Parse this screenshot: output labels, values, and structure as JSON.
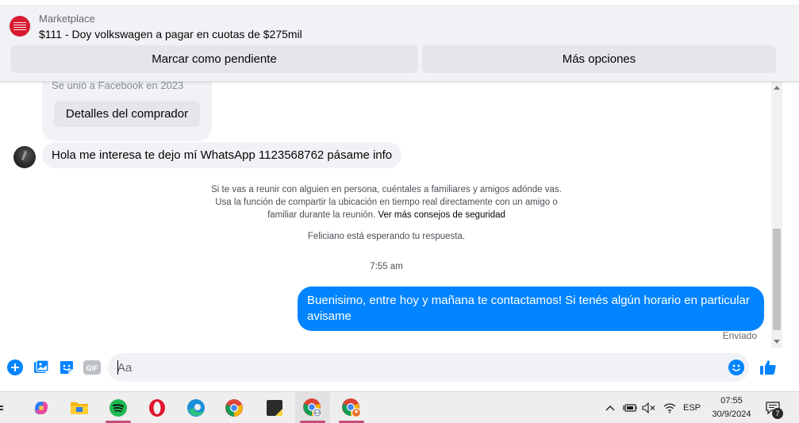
{
  "header": {
    "section": "Marketplace",
    "listing_title": "$111 - Doy volkswagen a pagar en cuotas de $275mil",
    "mark_pending_label": "Marcar como pendiente",
    "more_options_label": "Más opciones"
  },
  "buyer_card": {
    "joined_text": "Se unió a Facebook en 2023",
    "details_button": "Detalles del comprador"
  },
  "messages": {
    "incoming": "Hola me interesa te dejo mí WhatsApp 1123568762 pásame info",
    "outgoing": "Buenisimo, entre hoy y mañana te contactamos! Si tenés algún horario en particular avisame",
    "status": "Enviado"
  },
  "notices": {
    "safety_text": "Si te vas a reunir con alguien en persona, cuéntales a familiares y amigos adónde vas. Usa la función de compartir la ubicación en tiempo real directamente con un amigo o familiar durante la reunión.",
    "safety_link": "Ver más consejos de seguridad",
    "waiting": "Feliciano está esperando tu respuesta.",
    "time": "7:55 am"
  },
  "composer": {
    "placeholder": "Aa"
  },
  "taskbar": {
    "language": "ESP",
    "time": "07:55",
    "date": "30/9/2024",
    "notification_count": "7"
  },
  "colors": {
    "accent": "#0084ff",
    "header_bg": "#f0f2f5",
    "button_bg": "#e4e6eb"
  }
}
